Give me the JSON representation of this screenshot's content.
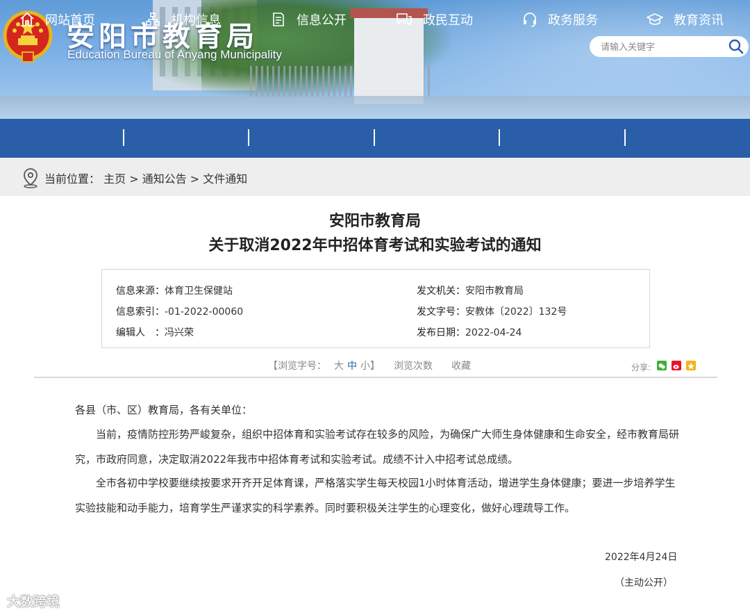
{
  "header": {
    "title": "安阳市教育局",
    "subtitle": "Education Bureau of Anyang Municipality",
    "search_placeholder": "请输入关键字"
  },
  "nav": {
    "items": [
      {
        "label": "网站首页",
        "icon": "home-icon"
      },
      {
        "label": "机构信息",
        "icon": "org-chart-icon"
      },
      {
        "label": "信息公开",
        "icon": "document-icon"
      },
      {
        "label": "政民互动",
        "icon": "chat-bubbles-icon"
      },
      {
        "label": "政务服务",
        "icon": "headset-icon"
      },
      {
        "label": "教育资讯",
        "icon": "graduation-cap-icon"
      }
    ]
  },
  "breadcrumb": {
    "prefix": "当前位置：",
    "items": [
      "主页",
      "通知公告",
      "文件通知"
    ],
    "separator": " > "
  },
  "article": {
    "org": "安阳市教育局",
    "title": "关于取消2022年中招体育考试和实验考试的通知"
  },
  "meta": {
    "source_label": "信息来源：",
    "source": "体育卫生保健站",
    "index_label": "信息索引：",
    "index": "-01-2022-00060",
    "editor_label": "编辑人　：",
    "editor": "冯兴荣",
    "issuer_label": "发文机关：",
    "issuer": "安阳市教育局",
    "doc_no_label": "发文字号：",
    "doc_no": "安教体〔2022〕132号",
    "date_label": "发布日期：",
    "date": "2022-04-24"
  },
  "tools": {
    "font_open": "【浏览字号：",
    "font_large": "大",
    "font_mid": "中",
    "font_small": "小",
    "font_close": "】",
    "views": "浏览次数",
    "favorite": "收藏",
    "share": "分享:"
  },
  "body": {
    "salutation": "各县（市、区）教育局，各有关单位：",
    "p1": "当前，疫情防控形势严峻复杂，组织中招体育和实验考试存在较多的风险，为确保广大师生身体健康和生命安全，经市教育局研究，市政府同意，决定取消2022年我市中招体育考试和实验考试。成绩不计入中招考试总成绩。",
    "p2": "全市各初中学校要继续按要求开齐开足体育课，严格落实学生每天校园1小时体育活动，增进学生身体健康；要进一步培养学生实验技能和动手能力，培育学生严谨求实的科学素养。同时要积极关注学生的心理变化，做好心理疏导工作。",
    "sign_date": "2022年4月24日",
    "sign_note": "（主动公开）"
  },
  "watermark": "大数跨境",
  "colors": {
    "nav_bg": "#2a5ea9",
    "crumb_bg": "#eeeeee",
    "share_wechat": "#3cb034",
    "share_weibo": "#e6162d",
    "share_fav": "#f5b21a"
  }
}
